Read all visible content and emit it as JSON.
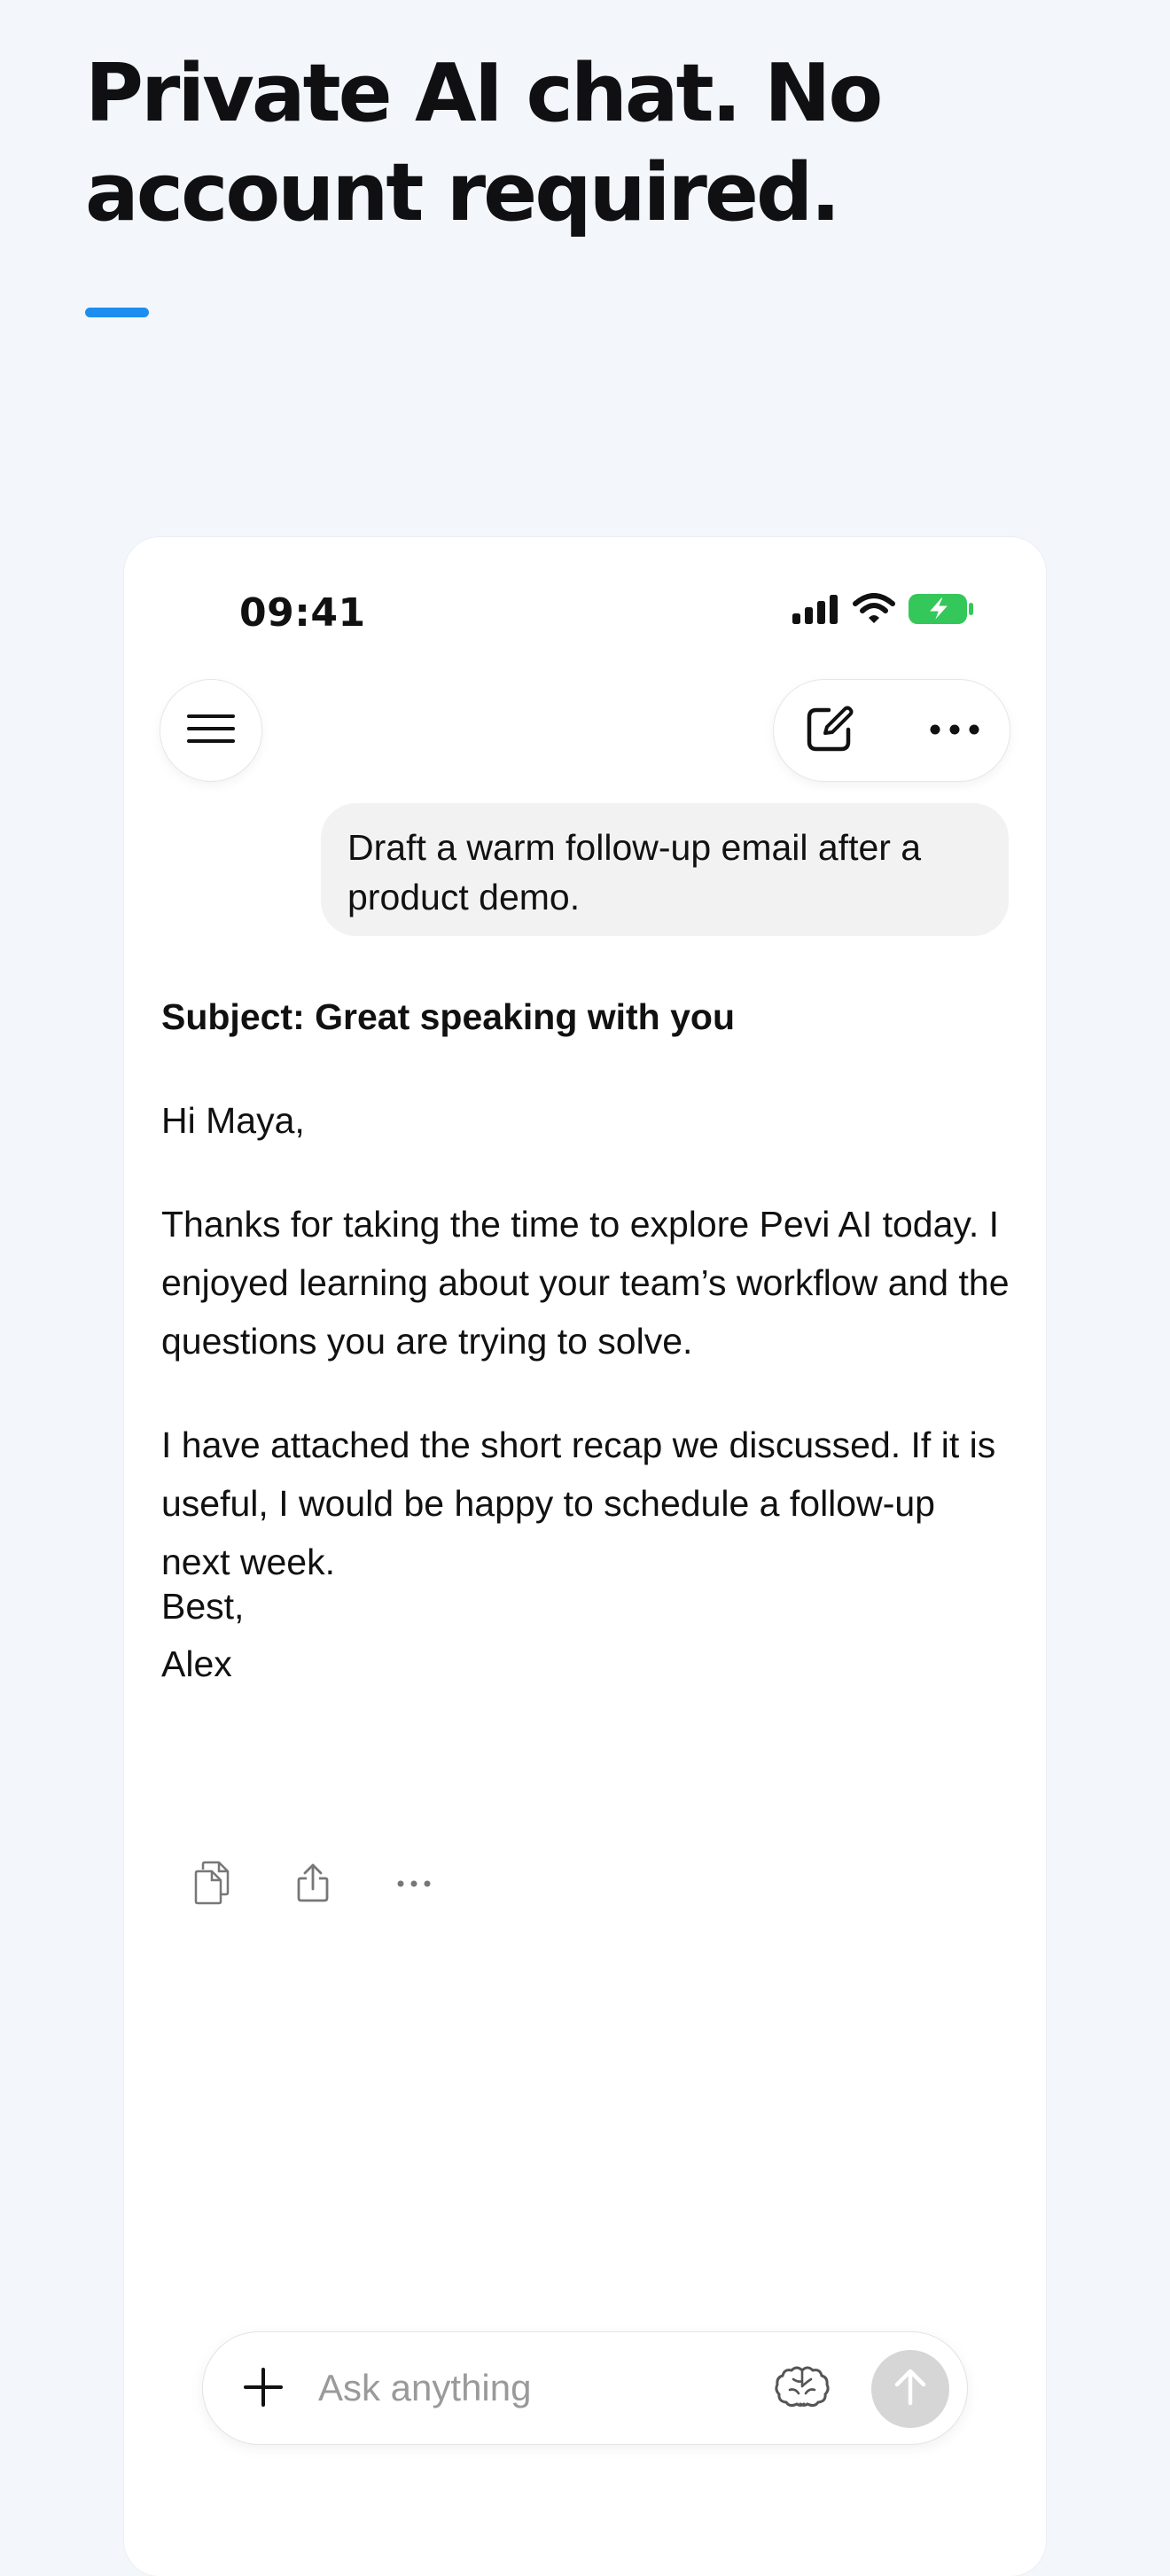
{
  "hero": {
    "headline": "Private AI chat. No account required.",
    "accent_color": "#1d8ef0"
  },
  "status_bar": {
    "time": "09:41",
    "icons": [
      "cellular-signal-icon",
      "wifi-icon",
      "battery-charging-icon"
    ],
    "battery_color": "#34c759"
  },
  "toolbar": {
    "menu_icon": "hamburger-icon",
    "compose_icon": "compose-icon",
    "more_icon": "ellipsis-icon"
  },
  "conversation": {
    "user_message": "Draft a warm follow-up email after a product demo.",
    "reply": {
      "subject": "Subject: Great speaking with you",
      "greeting": "Hi Maya,",
      "paragraph1": "Thanks for taking the time to explore Pevi AI today. I enjoyed learning about your team’s workflow and the questions you are trying to solve.",
      "paragraph2": "I have attached the short recap we discussed. If it is useful, I would be happy to schedule a follow-up next week.",
      "signoff": "Best,",
      "signature": "Alex"
    },
    "reply_actions": [
      "copy-icon",
      "share-icon",
      "ellipsis-icon"
    ]
  },
  "composer": {
    "placeholder": "Ask anything",
    "value": "",
    "icons": [
      "plus-icon",
      "brain-icon",
      "send-arrow-icon"
    ]
  }
}
